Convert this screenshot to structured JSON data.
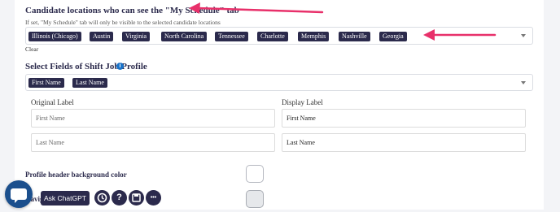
{
  "candidate_locations": {
    "title": "Candidate locations who can see the \"My Schedule\" tab",
    "hint": "If set, \"My Schedule\" tab will only be visible to the selected candidate locations",
    "tags": [
      "Illinois (Chicago)",
      "Austin",
      "Virginia",
      "North Carolina",
      "Tennessee",
      "Charlotte",
      "Memphis",
      "Nashville",
      "Georgia"
    ],
    "clear_label": "Clear"
  },
  "shift_fields": {
    "title": "Select Fields of Shift Job Profile",
    "info_icon": "i",
    "tags": [
      "First Name",
      "Last Name"
    ],
    "original_label_header": "Original Label",
    "display_label_header": "Display Label",
    "rows": [
      {
        "original": "First Name",
        "display": "First Name"
      },
      {
        "original": "Last Name",
        "display": "Last Name"
      }
    ]
  },
  "profile_header": {
    "label": "Profile header background color",
    "swatch_color": "#ffffff"
  },
  "navigation": {
    "label_fragment": "Navig",
    "swatch_color": "#e6e8eb"
  },
  "toolbar": {
    "ask_chatgpt": "Ask ChatGPT",
    "help_glyph": "?",
    "more_glyph": "•••"
  },
  "colors": {
    "accent": "#2b2a4c",
    "arrow": "#e8306a",
    "chat_bubble": "#1b4f8d"
  }
}
